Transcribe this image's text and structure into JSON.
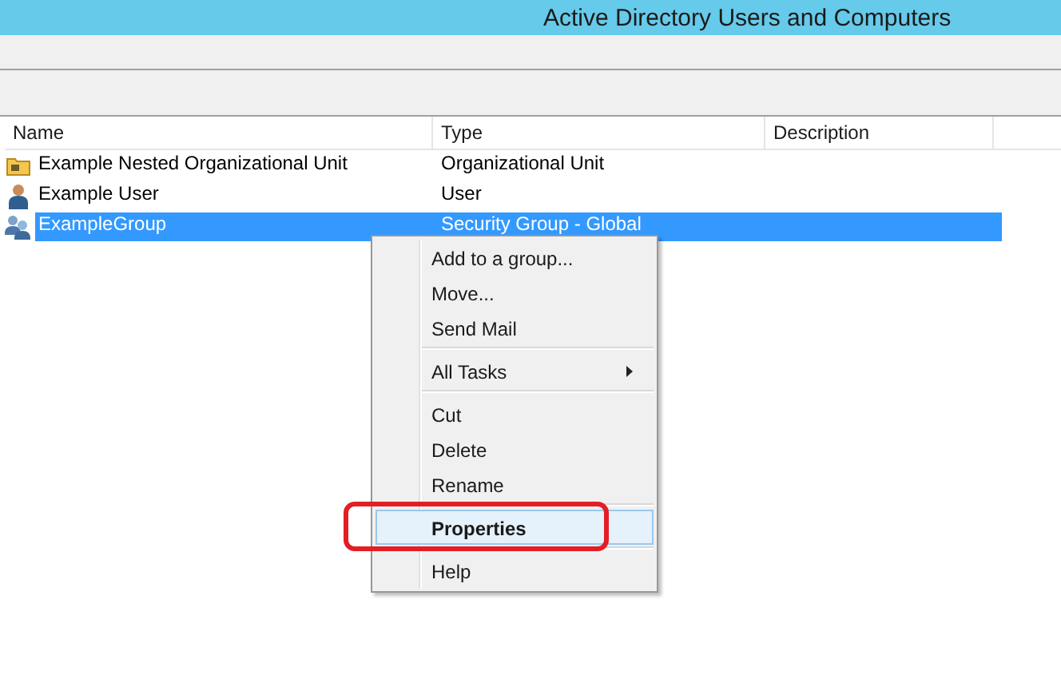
{
  "window": {
    "title": "Active Directory Users and Computers"
  },
  "list": {
    "columns": [
      {
        "label": "Name"
      },
      {
        "label": "Type"
      },
      {
        "label": "Description"
      }
    ],
    "rows": [
      {
        "kind": "ou",
        "name": "Example Nested Organizational Unit",
        "type": "Organizational Unit",
        "selected": false
      },
      {
        "kind": "user",
        "name": "Example User",
        "type": "User",
        "selected": false
      },
      {
        "kind": "group",
        "name": "ExampleGroup",
        "type": "Security Group - Global",
        "selected": true
      }
    ]
  },
  "context_menu": {
    "items": [
      {
        "kind": "item",
        "label": "Add to a group...",
        "submenu": false,
        "default": false,
        "selected": false,
        "circled": false
      },
      {
        "kind": "item",
        "label": "Move...",
        "submenu": false,
        "default": false,
        "selected": false,
        "circled": false
      },
      {
        "kind": "item",
        "label": "Send Mail",
        "submenu": false,
        "default": false,
        "selected": false,
        "circled": false
      },
      {
        "kind": "separator"
      },
      {
        "kind": "item",
        "label": "All Tasks",
        "submenu": true,
        "default": false,
        "selected": false,
        "circled": false
      },
      {
        "kind": "separator"
      },
      {
        "kind": "item",
        "label": "Cut",
        "submenu": false,
        "default": false,
        "selected": false,
        "circled": false
      },
      {
        "kind": "item",
        "label": "Delete",
        "submenu": false,
        "default": false,
        "selected": false,
        "circled": false
      },
      {
        "kind": "item",
        "label": "Rename",
        "submenu": false,
        "default": false,
        "selected": false,
        "circled": false
      },
      {
        "kind": "separator"
      },
      {
        "kind": "item",
        "label": "Properties",
        "submenu": false,
        "default": true,
        "selected": true,
        "circled": true
      },
      {
        "kind": "separator"
      },
      {
        "kind": "item",
        "label": "Help",
        "submenu": false,
        "default": false,
        "selected": false,
        "circled": false
      }
    ]
  }
}
